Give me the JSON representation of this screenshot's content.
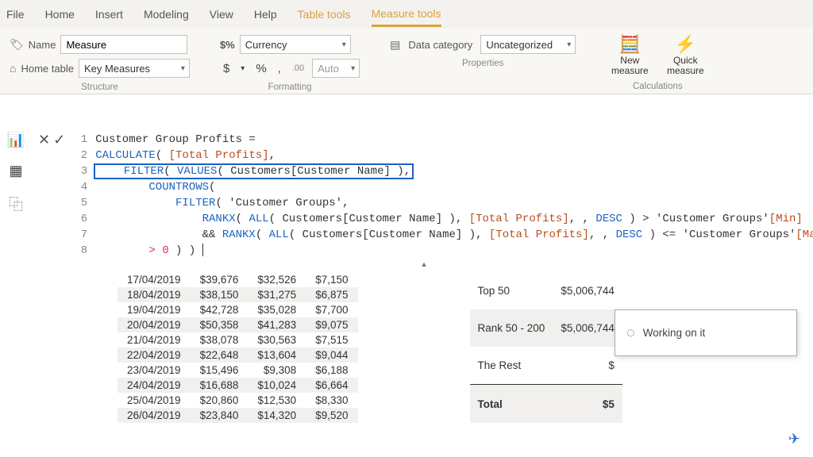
{
  "tabs": {
    "file": "File",
    "home": "Home",
    "insert": "Insert",
    "modeling": "Modeling",
    "view": "View",
    "help": "Help",
    "table_tools": "Table tools",
    "measure_tools": "Measure tools"
  },
  "ribbon": {
    "structure": {
      "group_label": "Structure",
      "name_label": "Name",
      "name_value": "Measure",
      "home_table_label": "Home table",
      "home_table_value": "Key Measures"
    },
    "formatting": {
      "group_label": "Formatting",
      "format_label": "$%",
      "format_value": "Currency",
      "currency_symbol": "$",
      "percent": "%",
      "comma": ",",
      "dec_inc": ".00",
      "auto": "Auto"
    },
    "properties": {
      "group_label": "Properties",
      "data_category_label": "Data category",
      "data_category_value": "Uncategorized"
    },
    "calculations": {
      "group_label": "Calculations",
      "new_measure": "New\nmeasure",
      "quick_measure": "Quick\nmeasure"
    }
  },
  "formula": {
    "lines": [
      "Customer Group Profits =",
      "CALCULATE( [Total Profits],",
      "    FILTER( VALUES( Customers[Customer Name] ),",
      "        COUNTROWS(",
      "            FILTER( 'Customer Groups',",
      "                RANKX( ALL( Customers[Customer Name] ), [Total Profits], , DESC ) > 'Customer Groups'[Min]",
      "                && RANKX( ALL( Customers[Customer Name] ), [Total Profits], , DESC ) <= 'Customer Groups'[Max] ) )",
      "        > 0 ) )"
    ]
  },
  "left_table": {
    "rows": [
      [
        "17/04/2019",
        "$39,676",
        "$32,526",
        "$7,150"
      ],
      [
        "18/04/2019",
        "$38,150",
        "$31,275",
        "$6,875"
      ],
      [
        "19/04/2019",
        "$42,728",
        "$35,028",
        "$7,700"
      ],
      [
        "20/04/2019",
        "$50,358",
        "$41,283",
        "$9,075"
      ],
      [
        "21/04/2019",
        "$38,078",
        "$30,563",
        "$7,515"
      ],
      [
        "22/04/2019",
        "$22,648",
        "$13,604",
        "$9,044"
      ],
      [
        "23/04/2019",
        "$15,496",
        "$9,308",
        "$6,188"
      ],
      [
        "24/04/2019",
        "$16,688",
        "$10,024",
        "$6,664"
      ],
      [
        "25/04/2019",
        "$20,860",
        "$12,530",
        "$8,330"
      ],
      [
        "26/04/2019",
        "$23,840",
        "$14,320",
        "$9,520"
      ]
    ]
  },
  "right_table": {
    "rows": [
      [
        "Top 50",
        "$5,006,744"
      ],
      [
        "Rank 50 - 200",
        "$5,006,744"
      ],
      [
        "The Rest",
        "$"
      ]
    ],
    "total_label": "Total",
    "total_value": "$5"
  },
  "popup": {
    "text": "Working on it"
  }
}
